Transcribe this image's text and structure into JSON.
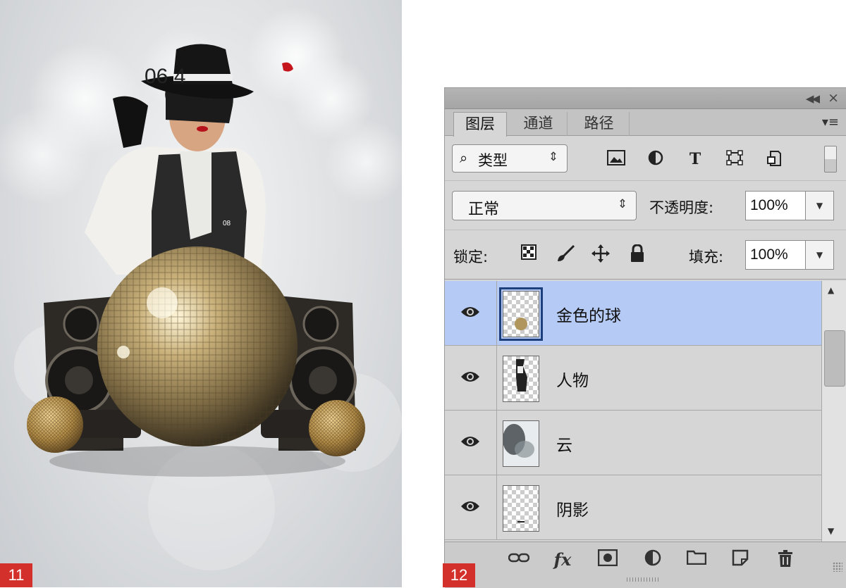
{
  "badges": {
    "left": "11",
    "right": "12"
  },
  "poster": {
    "number_text": "06 4",
    "pendant_text": "08"
  },
  "panel": {
    "tabs": [
      "图层",
      "通道",
      "路径"
    ],
    "filter": {
      "label": "类型"
    },
    "blend": {
      "mode": "正常",
      "opacity_label": "不透明度:",
      "opacity_value": "100%"
    },
    "lock": {
      "label": "锁定:",
      "fill_label": "填充:",
      "fill_value": "100%"
    },
    "layers": [
      {
        "name": "金色的球",
        "selected": true
      },
      {
        "name": "人物",
        "selected": false
      },
      {
        "name": "云",
        "selected": false
      },
      {
        "name": "阴影",
        "selected": false
      }
    ]
  },
  "colors": {
    "selected_row": "#b5cbf5",
    "badge": "#d3302b"
  }
}
